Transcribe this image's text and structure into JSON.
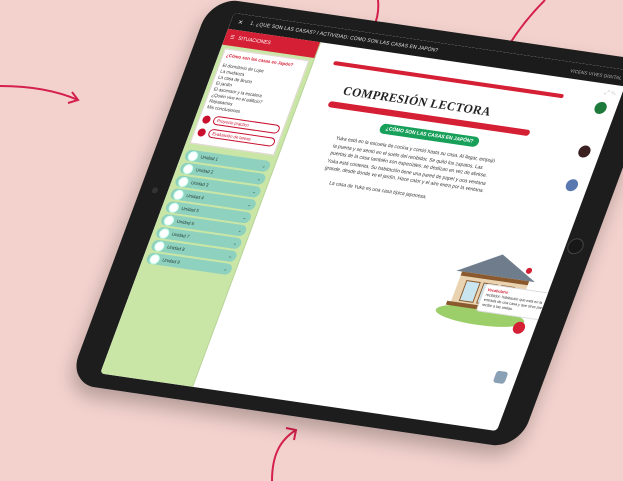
{
  "app": {
    "name": "VICENS VIVES DIGITAL",
    "breadcrumb": "1. ¿QUÉ SON LAS CASAS? / ACTIVIDAD: CÓMO SON LAS CASAS EN JAPÓN?",
    "icons": [
      "close-icon",
      "menu-icon"
    ]
  },
  "sidebar": {
    "header": "SITUACIONES",
    "active_item": "¿Cómo son las casas en Japón?",
    "items": [
      "El dormitorio de Lupe",
      "La mudanza",
      "La casa de Bruno",
      "El jardín",
      "El ascensor y la escalera",
      "¿Quién vive en el edificio?",
      "Repasamos",
      "Mis conclusiones"
    ],
    "buttons": [
      "Proyecto práctico",
      "Evaluación de tareas"
    ],
    "units": [
      "Unidad 1",
      "Unidad 2",
      "Unidad 3",
      "Unidad 4",
      "Unidad 5",
      "Unidad 6",
      "Unidad 7",
      "Unidad 8",
      "Unidad 9"
    ]
  },
  "content": {
    "title": "COMPRESIÓN LECTORA",
    "subtitle": "¿CÓMO SON LAS CASAS EN JAPÓN?",
    "paragraph": "Yuka está en la escuela de cocina y comió hasta su casa. Al llegar, empujó la puerta y se sentó en el suelo del recibidor. Se quitó los zapatos. Las puertas de la casa también son especiales: se deslizan en vez de abrirse. Yuka está contenta. Su habitación tiene una pared de papel y una ventana grande, desde donde ve el jardín. Hace calor y el aire entra por la ventana.",
    "paragraph2": "La casa de Yuka es una casa típica japonesa.",
    "note_title": "Vocabulario",
    "note_body": "recibidor: habitación que está en la entrada de una casa y que sirve para recibir a las visitas."
  },
  "colors": {
    "accent": "#d51f35",
    "sidebar": "#c9e6a6",
    "unit": "#8fd1bf",
    "pill": "#18a05a",
    "background": "#f3d2cd"
  }
}
